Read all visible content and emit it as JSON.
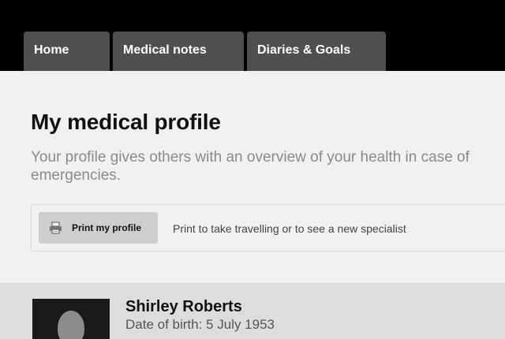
{
  "nav": {
    "tabs": [
      {
        "label": "Home"
      },
      {
        "label": "Medical notes"
      },
      {
        "label": "Diaries & Goals"
      }
    ]
  },
  "page": {
    "title": "My medical profile",
    "intro": "Your profile gives others with an overview of your health in case of emergencies."
  },
  "print": {
    "icon": "printer-icon",
    "button_label": "Print my profile",
    "hint": "Print to take travelling or to see a new specialist"
  },
  "profile": {
    "avatar_icon": "user-silhouette-icon",
    "name": "Shirley Roberts",
    "dob": "Date of birth: 5 July 1953"
  },
  "colors": {
    "header_bg": "#000000",
    "tab_bg": "#4f4f4f",
    "page_bg": "#f1f1f1",
    "band_bg": "#dddddd"
  }
}
